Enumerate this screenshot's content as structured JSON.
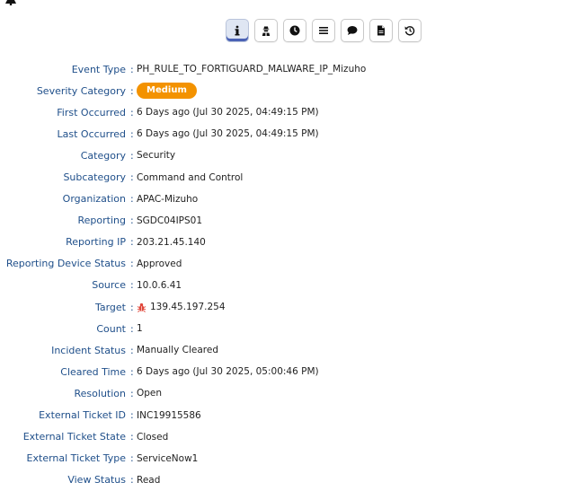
{
  "toolbar": {
    "buttons": [
      {
        "icon": "info-icon",
        "active": true
      },
      {
        "icon": "user-secret-icon",
        "active": false
      },
      {
        "icon": "clock-icon",
        "active": false
      },
      {
        "icon": "list-icon",
        "active": false
      },
      {
        "icon": "comment-icon",
        "active": false
      },
      {
        "icon": "file-icon",
        "active": false
      },
      {
        "icon": "history-icon",
        "active": false
      }
    ]
  },
  "details": {
    "event_type": {
      "label": "Event Type",
      "value": "PH_RULE_TO_FORTIGUARD_MALWARE_IP_Mizuho"
    },
    "severity_category": {
      "label": "Severity Category",
      "value": "Medium",
      "color": "#f39200"
    },
    "first_occurred": {
      "label": "First Occurred",
      "value": "6 Days ago (Jul 30 2025, 04:49:15 PM)"
    },
    "last_occurred": {
      "label": "Last Occurred",
      "value": "6 Days ago (Jul 30 2025, 04:49:15 PM)"
    },
    "category": {
      "label": "Category",
      "value": "Security"
    },
    "subcategory": {
      "label": "Subcategory",
      "value": "Command and Control"
    },
    "organization": {
      "label": "Organization",
      "value": "APAC-Mizuho"
    },
    "reporting": {
      "label": "Reporting",
      "value": "SGDC04IPS01"
    },
    "reporting_ip": {
      "label": "Reporting IP",
      "value": "203.21.45.140"
    },
    "reporting_device_status": {
      "label": "Reporting Device Status",
      "value": "Approved"
    },
    "source": {
      "label": "Source",
      "value": "10.0.6.41"
    },
    "target": {
      "label": "Target",
      "value": "139.45.197.254",
      "icon": "bug-icon"
    },
    "count": {
      "label": "Count",
      "value": "1"
    },
    "incident_status": {
      "label": "Incident Status",
      "value": "Manually Cleared"
    },
    "cleared_time": {
      "label": "Cleared Time",
      "value": "6 Days ago (Jul 30 2025, 05:00:46 PM)"
    },
    "resolution": {
      "label": "Resolution",
      "value": "Open"
    },
    "external_ticket_id": {
      "label": "External Ticket ID",
      "value": "INC19915586"
    },
    "external_ticket_state": {
      "label": "External Ticket State",
      "value": "Closed"
    },
    "external_ticket_type": {
      "label": "External Ticket Type",
      "value": "ServiceNow1"
    },
    "view_status": {
      "label": "View Status",
      "value": "Read"
    }
  },
  "colon": ":"
}
